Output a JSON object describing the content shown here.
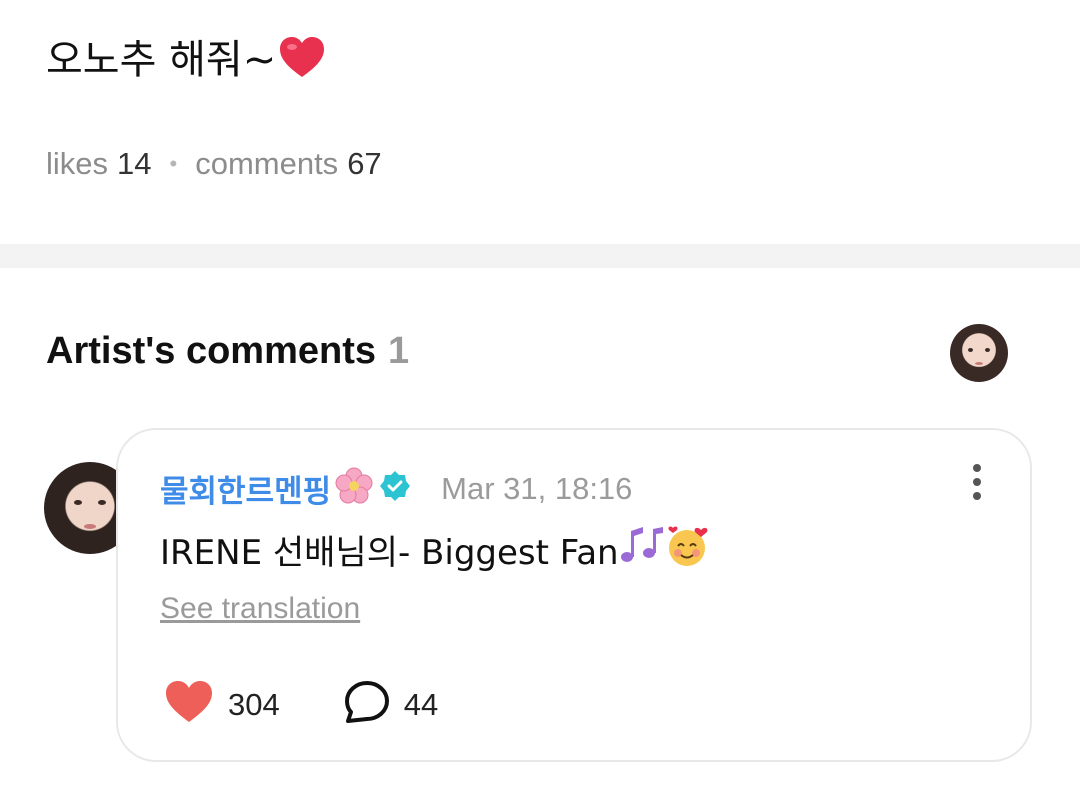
{
  "post": {
    "text": "오노추 해줘~",
    "emoji_icon": "red-heart-emoji"
  },
  "stats": {
    "likes_label": "likes",
    "likes_count": "14",
    "comments_label": "comments",
    "comments_count": "67"
  },
  "artist_comments": {
    "title": "Artist's comments",
    "count": "1"
  },
  "comment": {
    "username": "물회한르멘핑",
    "timestamp": "Mar 31, 18:16",
    "text": "IRENE 선배님의- Biggest Fan",
    "see_translation": "See translation",
    "like_count": "304",
    "reply_count": "44"
  },
  "colors": {
    "username": "#3f8ce8",
    "like_heart": "#ef5350",
    "verified": "#2cc3d3",
    "divider": "#f3f3f3"
  }
}
